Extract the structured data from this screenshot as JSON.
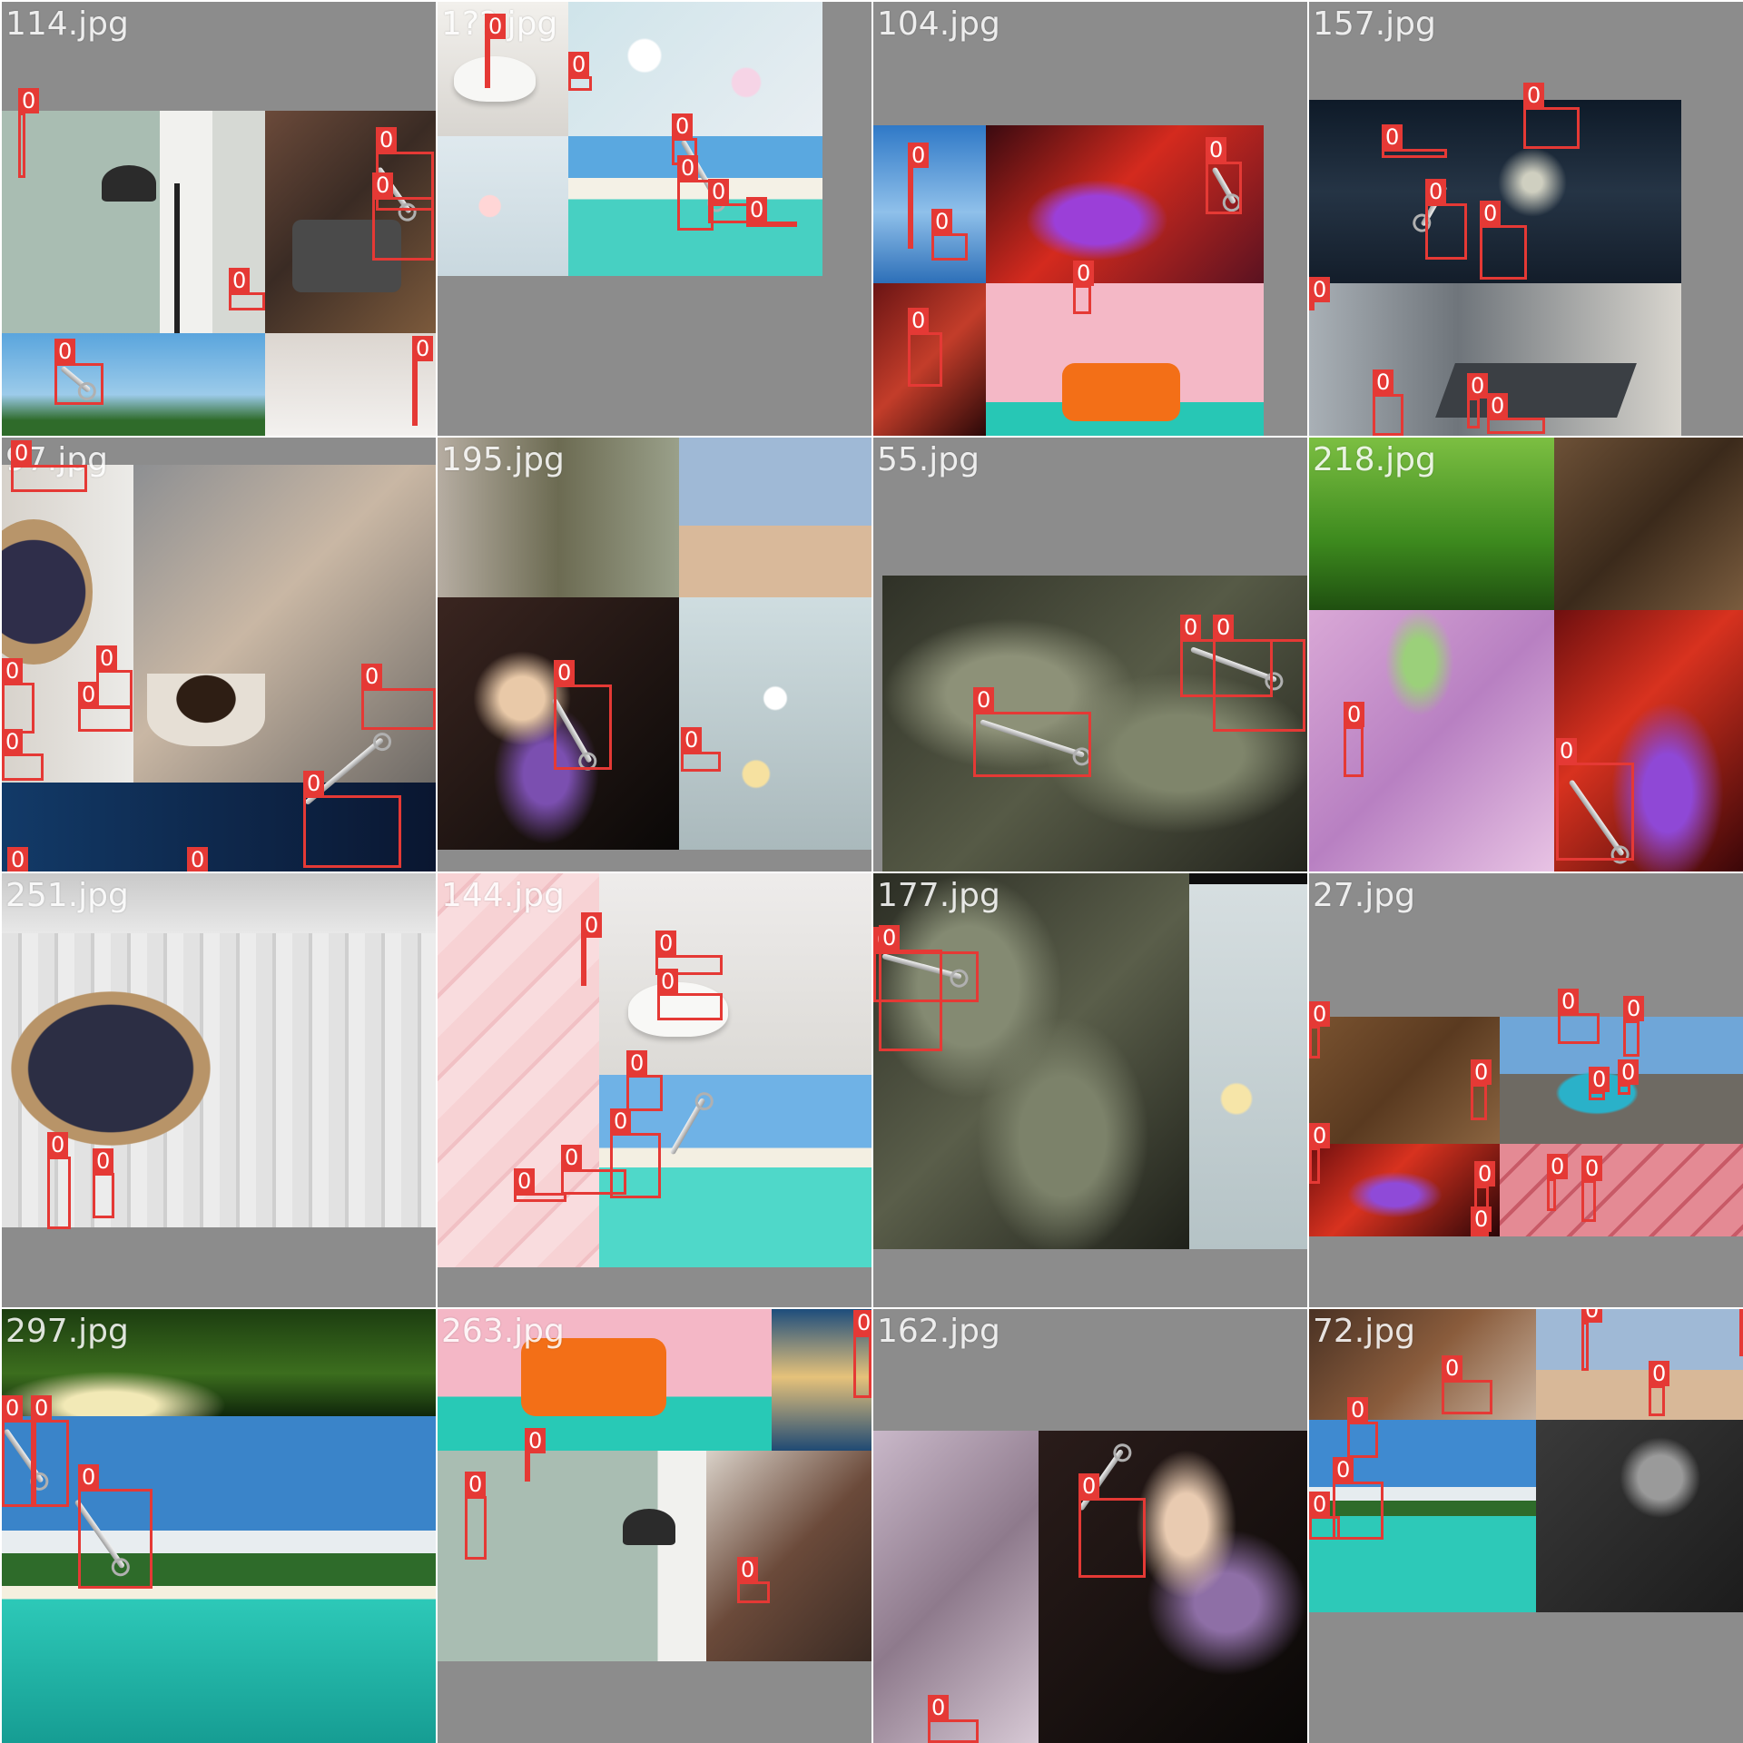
{
  "mosaic": {
    "class_label": "0",
    "cells": [
      {
        "filename": "114.jpg"
      },
      {
        "filename": "1??.jpg"
      },
      {
        "filename": "104.jpg"
      },
      {
        "filename": "157.jpg"
      },
      {
        "filename": "97.jpg"
      },
      {
        "filename": "195.jpg"
      },
      {
        "filename": "55.jpg"
      },
      {
        "filename": "218.jpg"
      },
      {
        "filename": "251.jpg"
      },
      {
        "filename": "144.jpg"
      },
      {
        "filename": "177.jpg"
      },
      {
        "filename": "27.jpg"
      },
      {
        "filename": "297.jpg"
      },
      {
        "filename": "263.jpg"
      },
      {
        "filename": "162.jpg"
      },
      {
        "filename": "72.jpg"
      }
    ]
  }
}
